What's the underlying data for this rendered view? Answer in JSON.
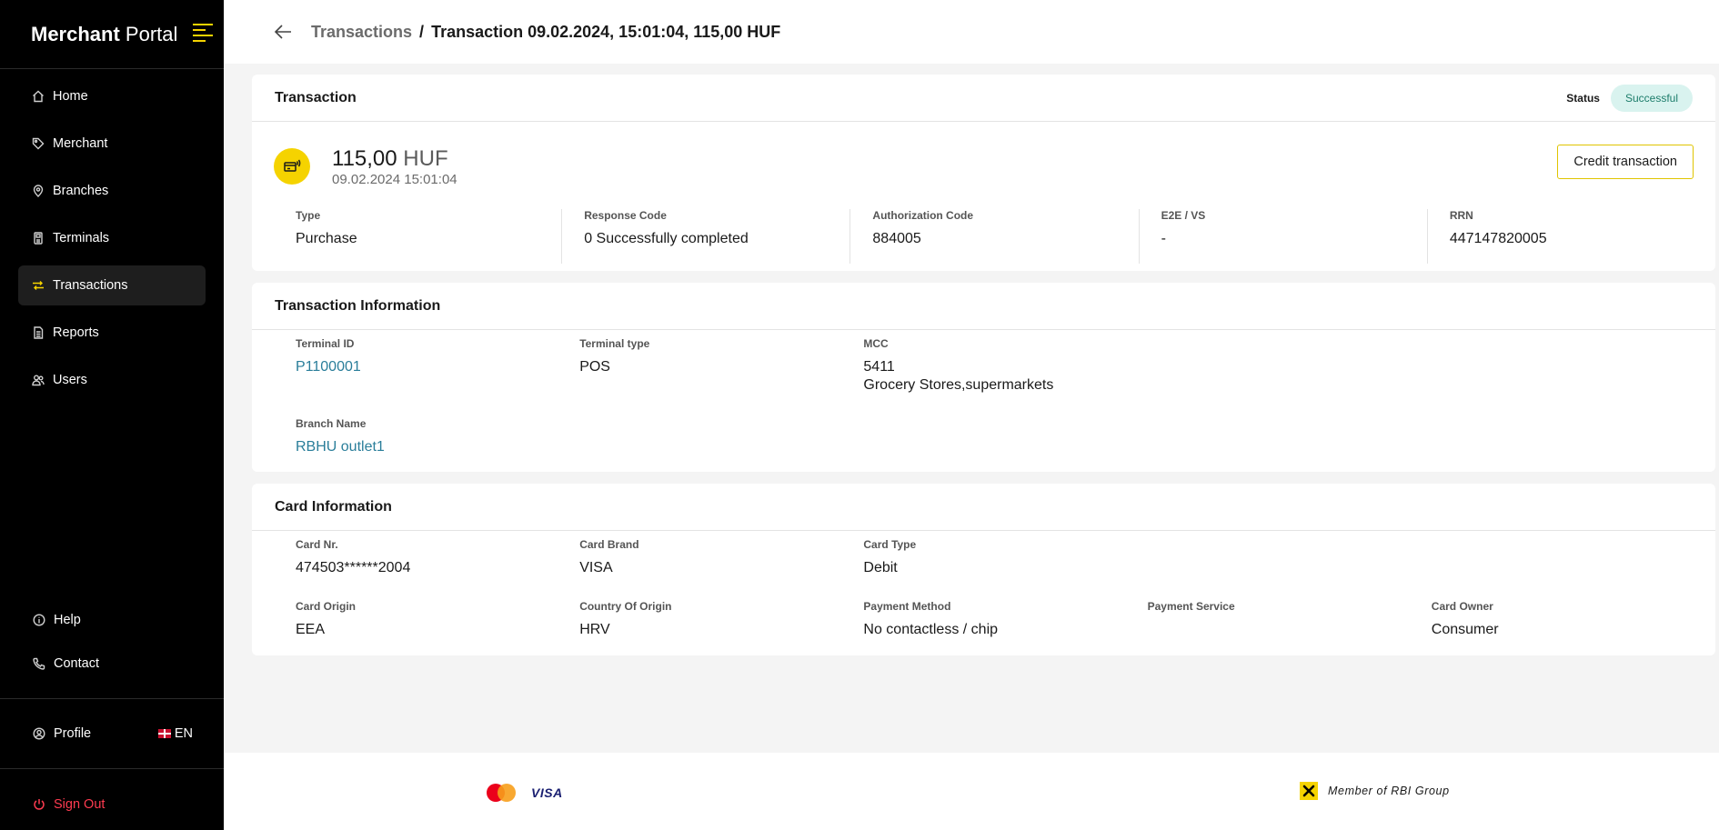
{
  "sidebar": {
    "logo_bold": "Merchant",
    "logo_light": "Portal",
    "nav": [
      {
        "label": "Home",
        "icon": "home-icon"
      },
      {
        "label": "Merchant",
        "icon": "tag-icon"
      },
      {
        "label": "Branches",
        "icon": "location-pin-icon"
      },
      {
        "label": "Terminals",
        "icon": "terminal-icon"
      },
      {
        "label": "Transactions",
        "icon": "transfer-arrows-icon",
        "active": true
      },
      {
        "label": "Reports",
        "icon": "document-icon"
      },
      {
        "label": "Users",
        "icon": "users-icon"
      }
    ],
    "help": "Help",
    "contact": "Contact",
    "profile": "Profile",
    "language": "EN",
    "signout": "Sign Out"
  },
  "header": {
    "breadcrumb_parent": "Transactions",
    "breadcrumb_sep": "/",
    "breadcrumb_current": "Transaction 09.02.2024, 15:01:04, 115,00 HUF"
  },
  "transaction": {
    "title": "Transaction",
    "status_label": "Status",
    "status_value": "Successful",
    "amount": "115,00",
    "currency": "HUF",
    "datetime": "09.02.2024 15:01:04",
    "credit_button": "Credit transaction",
    "summary": [
      {
        "label": "Type",
        "value": "Purchase"
      },
      {
        "label": "Response Code",
        "value": "0 Successfully completed"
      },
      {
        "label": "Authorization Code",
        "value": "884005"
      },
      {
        "label": "E2E / VS",
        "value": "-"
      },
      {
        "label": "RRN",
        "value": "447147820005"
      }
    ]
  },
  "transaction_info": {
    "title": "Transaction Information",
    "terminal_id_label": "Terminal ID",
    "terminal_id": "P1100001",
    "terminal_type_label": "Terminal type",
    "terminal_type": "POS",
    "mcc_label": "MCC",
    "mcc_code": "5411",
    "mcc_desc": "Grocery Stores,supermarkets",
    "branch_name_label": "Branch Name",
    "branch_name": "RBHU outlet1"
  },
  "card_info": {
    "title": "Card Information",
    "fields": [
      {
        "label": "Card Nr.",
        "value": "474503******2004"
      },
      {
        "label": "Card Brand",
        "value": "VISA"
      },
      {
        "label": "Card Type",
        "value": "Debit"
      },
      {
        "label": "",
        "value": ""
      },
      {
        "label": "",
        "value": ""
      },
      {
        "label": "Card Origin",
        "value": "EEA"
      },
      {
        "label": "Country Of Origin",
        "value": "HRV"
      },
      {
        "label": "Payment Method",
        "value": "No contactless / chip"
      },
      {
        "label": "Payment Service",
        "value": ""
      },
      {
        "label": "Card Owner",
        "value": "Consumer"
      }
    ]
  },
  "footer": {
    "visa_logo": "VISA",
    "rbi_text": "Member of RBI Group"
  },
  "colors": {
    "accent": "#f5d300",
    "success_bg": "#d9f3ef",
    "success_text": "#1d7d6b",
    "link": "#2a7e9a",
    "danger": "#ff3b50"
  }
}
